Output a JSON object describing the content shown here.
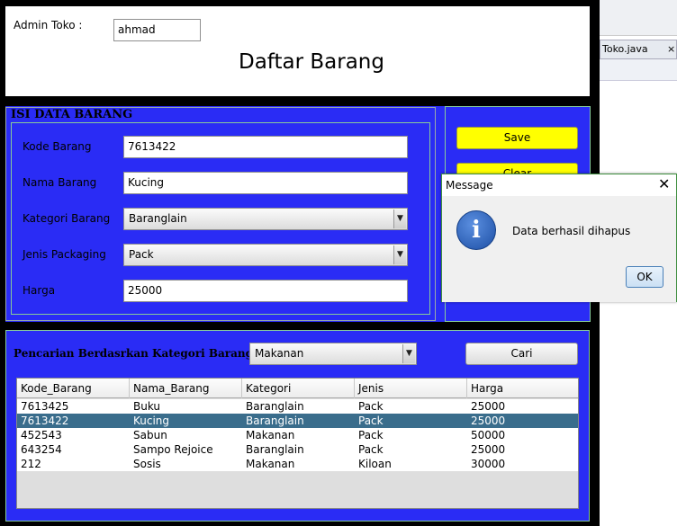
{
  "header": {
    "admin_label": "Admin Toko :",
    "admin_value": "ahmad",
    "title": "Daftar Barang"
  },
  "form": {
    "section_title": "ISI DATA BARANG",
    "fields": [
      {
        "label": "Kode Barang",
        "value": "7613422"
      },
      {
        "label": "Nama Barang",
        "value": "Kucing"
      },
      {
        "label": "Kategori Barang",
        "value": "Baranglain"
      },
      {
        "label": "Jenis Packaging",
        "value": "Pack"
      },
      {
        "label": "Harga",
        "value": "25000"
      }
    ]
  },
  "buttons": {
    "save": "Save",
    "clear": "Clear"
  },
  "search": {
    "label": "Pencarian Berdasrkan Kategori Barang",
    "category_value": "Makanan",
    "button": "Cari"
  },
  "table": {
    "columns": [
      "Kode_Barang",
      "Nama_Barang",
      "Kategori",
      "Jenis",
      "Harga"
    ],
    "rows": [
      [
        "7613425",
        "Buku",
        "Baranglain",
        "Pack",
        "25000"
      ],
      [
        "7613422",
        "Kucing",
        "Baranglain",
        "Pack",
        "25000"
      ],
      [
        "452543",
        "Sabun",
        "Makanan",
        "Pack",
        "50000"
      ],
      [
        "643254",
        "Sampo Rejoice",
        "Baranglain",
        "Pack",
        "25000"
      ],
      [
        "212",
        "Sosis",
        "Makanan",
        "Kiloan",
        "30000"
      ]
    ],
    "selected_row": 1
  },
  "ide": {
    "tab_label": "Toko.java",
    "tab_close": "×"
  },
  "dialog": {
    "title": "Message",
    "close": "✕",
    "icon": "i",
    "message": "Data berhasil dihapus",
    "ok": "OK"
  },
  "colors": {
    "panel_blue": "#2a2cf5",
    "button_yellow": "#ffff00",
    "selection": "#3a6d8c"
  }
}
